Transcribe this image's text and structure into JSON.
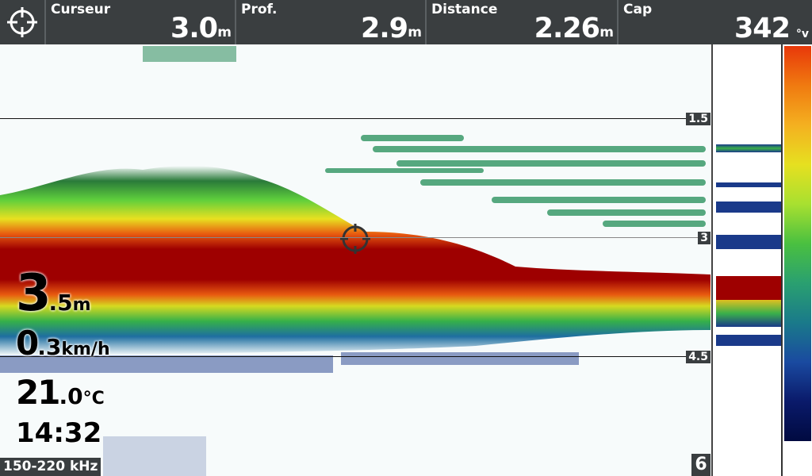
{
  "topbar": {
    "cells": [
      {
        "label": "Curseur",
        "value": "3.0",
        "unit": "m"
      },
      {
        "label": "Prof.",
        "value": "2.9",
        "unit": "m"
      },
      {
        "label": "Distance",
        "value": "2.26",
        "unit": "m"
      },
      {
        "label": "Cap",
        "value": "342",
        "unit": "°v"
      }
    ]
  },
  "depth_marks": [
    "1.5",
    "3",
    "4.5"
  ],
  "readouts": {
    "depth_int": "3",
    "depth_dec": ".5",
    "depth_unit": "m",
    "speed_int": "0",
    "speed_dec": ".3",
    "speed_unit": "km/h",
    "temp_int": "21",
    "temp_dec": ".0",
    "temp_unit": "°C",
    "time": "14:32"
  },
  "frequency": "150-220 kHz",
  "page_number": "6",
  "colors": {
    "bar": "#3a3e40",
    "bottom": "#9e0000",
    "water": "#f7fbfb"
  }
}
